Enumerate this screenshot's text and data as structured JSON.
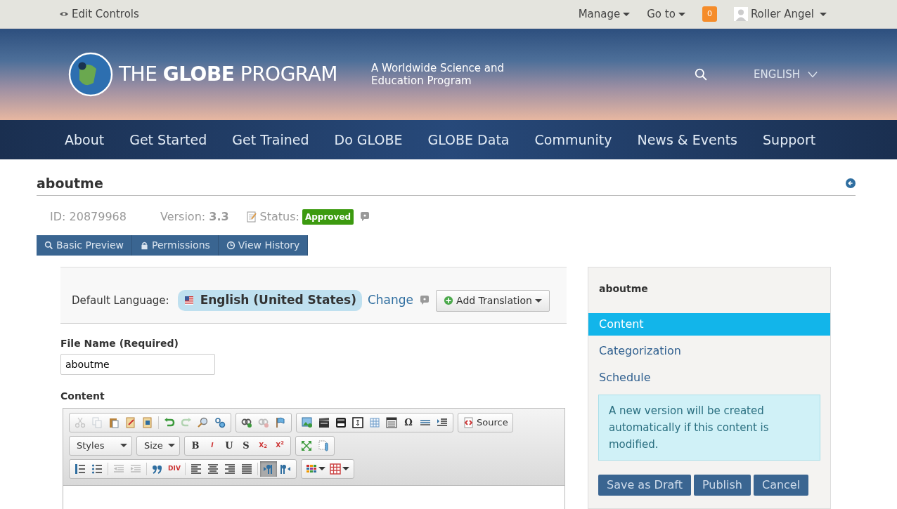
{
  "top_bar": {
    "edit_controls": "Edit Controls",
    "menus": [
      {
        "label": "Manage"
      },
      {
        "label": "Go to"
      }
    ],
    "notification_count": "0",
    "user": "Roller Angel"
  },
  "header": {
    "logo": "THE **GLOBE** PROGRAM",
    "tagline": "A Worldwide Science and Education Program",
    "language": "ENGLISH"
  },
  "nav": [
    {
      "label": "About"
    },
    {
      "label": "Get Started"
    },
    {
      "label": "Get Trained"
    },
    {
      "label": "Do GLOBE"
    },
    {
      "label": "GLOBE Data"
    },
    {
      "label": "Community"
    },
    {
      "label": "News & Events"
    },
    {
      "label": "Support"
    }
  ],
  "page": {
    "title": "aboutme",
    "id": "ID: 20879968",
    "version_label": "Version:",
    "version": "3.3",
    "status_label": "Status:",
    "status": "Approved"
  },
  "action_buttons": [
    {
      "label": "Basic Preview"
    },
    {
      "label": "Permissions"
    },
    {
      "label": "View History"
    }
  ],
  "language_bar": {
    "label": "Default Language:",
    "language": "English (United States)",
    "change": "Change",
    "add_translation": "Add Translation"
  },
  "file_name": {
    "label": "File Name (Required)",
    "value": "aboutme"
  },
  "content_label": "Content",
  "toolbar": [
    [
      [
        {
          "kind": "icon",
          "disabled": true,
          "selected": false
        },
        {
          "kind": "icon",
          "disabled": true,
          "selected": false
        },
        {
          "kind": "icon",
          "disabled": false,
          "selected": false
        },
        {
          "kind": "icon",
          "disabled": false,
          "selected": false
        },
        {
          "kind": "icon",
          "disabled": false,
          "selected": false
        },
        {
          "kind": "separator"
        },
        {
          "kind": "icon",
          "disabled": false,
          "selected": false
        },
        {
          "kind": "icon",
          "disabled": true,
          "selected": false
        },
        {
          "kind": "icon",
          "disabled": false,
          "selected": false
        },
        {
          "kind": "icon",
          "disabled": false,
          "selected": false
        }
      ],
      [
        {
          "kind": "icon",
          "disabled": false,
          "selected": false
        },
        {
          "kind": "icon",
          "disabled": true,
          "selected": false
        },
        {
          "kind": "icon",
          "disabled": false,
          "selected": false
        }
      ],
      [
        {
          "kind": "icon",
          "disabled": false,
          "selected": false
        },
        {
          "kind": "icon",
          "disabled": false,
          "selected": false
        },
        {
          "kind": "icon",
          "disabled": false,
          "selected": false
        },
        {
          "kind": "icon",
          "disabled": false,
          "selected": false
        },
        {
          "kind": "icon",
          "disabled": false,
          "selected": false
        },
        {
          "kind": "icon",
          "disabled": false,
          "selected": false
        },
        {
          "kind": "text",
          "label": "Ω",
          "disabled": false,
          "selected": false
        },
        {
          "kind": "icon",
          "disabled": false,
          "selected": false
        },
        {
          "kind": "icon",
          "disabled": false,
          "selected": false
        }
      ],
      [
        {
          "kind": "icon",
          "label": "Source",
          "disabled": false,
          "selected": false
        }
      ]
    ],
    [
      [
        {
          "kind": "combo",
          "label": "Styles"
        }
      ],
      [
        {
          "kind": "combo",
          "label": "Size"
        }
      ],
      [
        {
          "kind": "text",
          "label": "B",
          "disabled": false,
          "selected": false
        },
        {
          "kind": "text",
          "label": "*I*",
          "disabled": false,
          "selected": false
        },
        {
          "kind": "text",
          "label": "U",
          "disabled": false,
          "selected": false
        },
        {
          "kind": "text",
          "label": "S",
          "disabled": false,
          "selected": false
        },
        {
          "kind": "text",
          "label": "X$_{2}$",
          "disabled": false,
          "selected": false
        },
        {
          "kind": "text",
          "label": "X$^{2}$",
          "disabled": false,
          "selected": false
        }
      ],
      [
        {
          "kind": "icon",
          "disabled": false,
          "selected": false
        },
        {
          "kind": "icon",
          "disabled": false,
          "selected": false
        }
      ]
    ],
    [
      [
        {
          "kind": "icon",
          "disabled": false,
          "selected": false
        },
        {
          "kind": "icon",
          "disabled": false,
          "selected": false
        },
        {
          "kind": "separator"
        },
        {
          "kind": "icon",
          "disabled": true,
          "selected": false
        },
        {
          "kind": "icon",
          "disabled": true,
          "selected": false
        },
        {
          "kind": "separator"
        },
        {
          "kind": "icon",
          "disabled": false,
          "selected": false
        },
        {
          "kind": "text",
          "label": "DIV",
          "disabled": false,
          "selected": false
        },
        {
          "kind": "separator"
        },
        {
          "kind": "icon",
          "disabled": false,
          "selected": false
        },
        {
          "kind": "icon",
          "disabled": false,
          "selected": false
        },
        {
          "kind": "icon",
          "disabled": false,
          "selected": false
        },
        {
          "kind": "icon",
          "disabled": false,
          "selected": false
        },
        {
          "kind": "separator"
        },
        {
          "kind": "icon",
          "disabled": false,
          "selected": true
        },
        {
          "kind": "icon",
          "disabled": false,
          "selected": false
        }
      ],
      [
        {
          "kind": "icon",
          "dropdown": true,
          "disabled": false,
          "selected": false
        },
        {
          "kind": "icon",
          "dropdown": true,
          "disabled": false,
          "selected": false
        }
      ]
    ]
  ],
  "sidebar": {
    "title": "aboutme",
    "items": [
      {
        "label": "Content",
        "selected": true
      },
      {
        "label": "Categorization",
        "selected": false
      },
      {
        "label": "Schedule",
        "selected": false
      }
    ],
    "notice": "A new version will be created automatically if this content is modified.",
    "buttons": [
      "Save as Draft",
      "Publish",
      "Cancel"
    ]
  }
}
